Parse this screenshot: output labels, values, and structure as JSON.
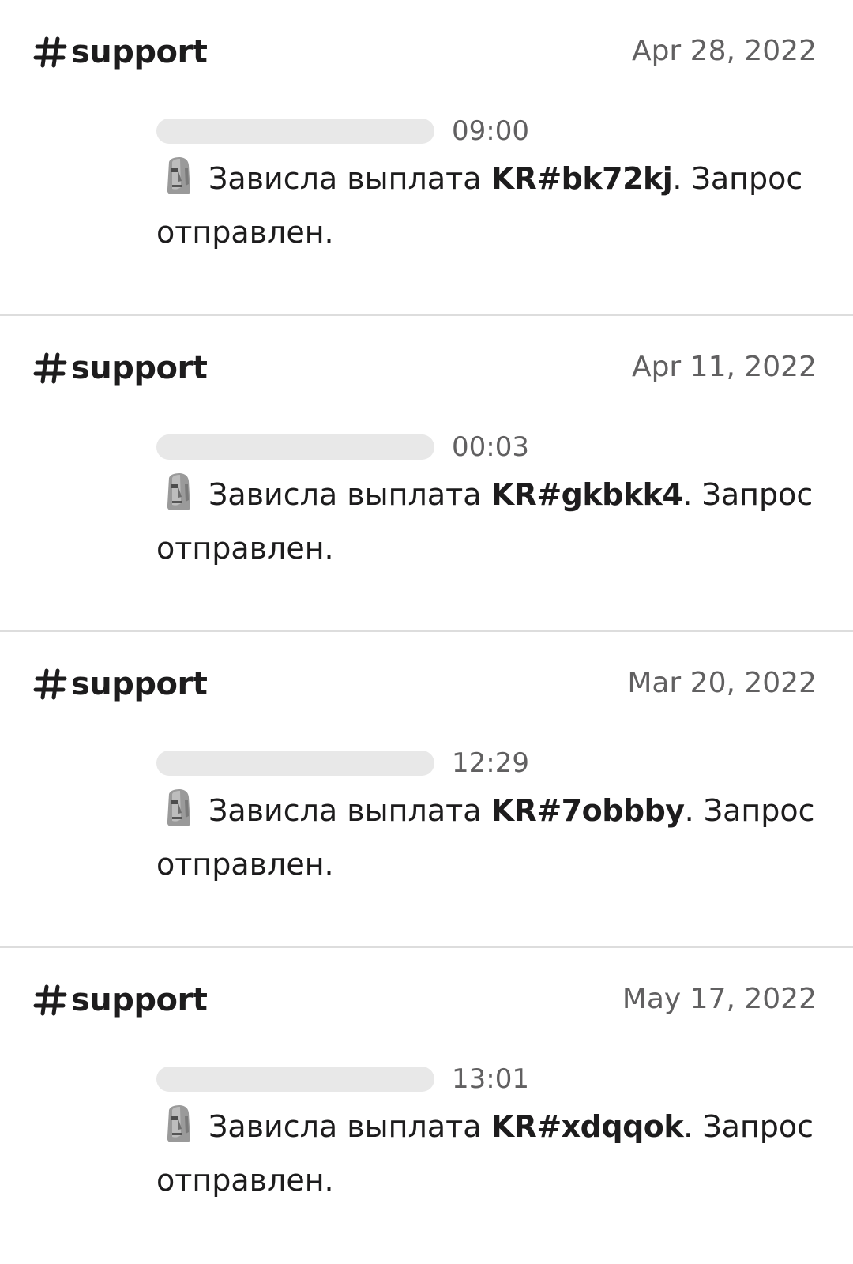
{
  "results": [
    {
      "channel": "support",
      "date": "Apr 28, 2022",
      "time": "09:00",
      "text_before": "Зависла выплата ",
      "code": "KR#bk72kj",
      "text_after": ". Запрос отправлен.",
      "icon": "moai-icon"
    },
    {
      "channel": "support",
      "date": "Apr 11, 2022",
      "time": "00:03",
      "text_before": "Зависла выплата ",
      "code": "KR#gkbkk4",
      "text_after": ". Запрос отправлен.",
      "icon": "moai-icon"
    },
    {
      "channel": "support",
      "date": "Mar 20, 2022",
      "time": "12:29",
      "text_before": "Зависла выплата ",
      "code": "KR#7obbby",
      "text_after": ". Запрос отправлен.",
      "icon": "moai-icon"
    },
    {
      "channel": "support",
      "date": "May 17, 2022",
      "time": "13:01",
      "text_before": "Зависла выплата ",
      "code": "KR#xdqqok",
      "text_after": ". Запрос отправлен.",
      "icon": "moai-icon"
    }
  ]
}
